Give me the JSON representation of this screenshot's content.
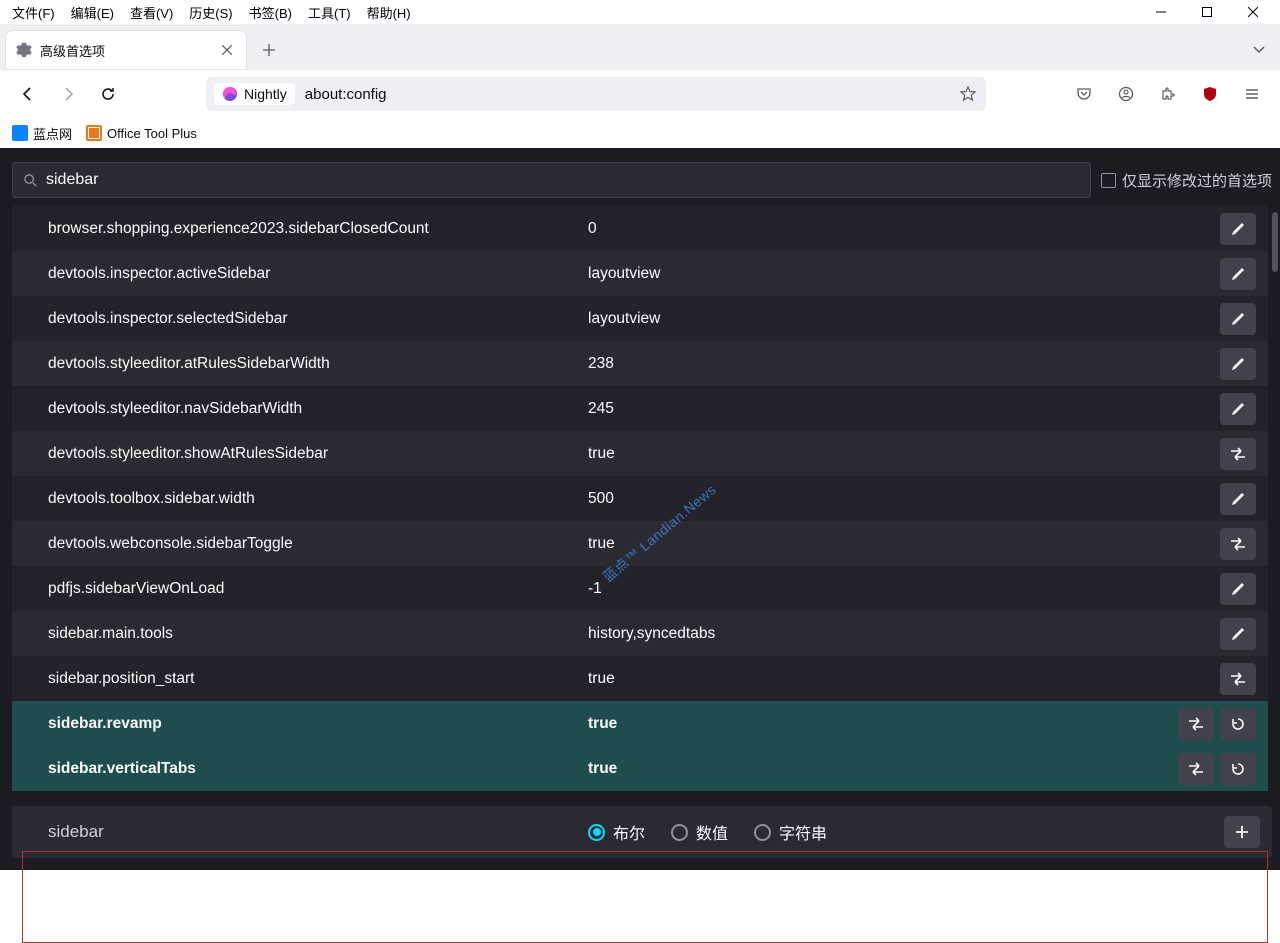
{
  "menubar": [
    "文件(F)",
    "编辑(E)",
    "查看(V)",
    "历史(S)",
    "书签(B)",
    "工具(T)",
    "帮助(H)"
  ],
  "tab": {
    "title": "高级首选项"
  },
  "urlbar": {
    "identity": "Nightly",
    "url": "about:config"
  },
  "bookmarks": [
    {
      "label": "蓝点网"
    },
    {
      "label": "Office Tool Plus"
    }
  ],
  "config": {
    "search_value": "sidebar",
    "modified_only_label": "仅显示修改过的首选项",
    "watermark": "蓝点™ Landian.News",
    "prefs": [
      {
        "name": "browser.shopping.experience2023.sidebarClosedCount",
        "value": "0",
        "action": "edit"
      },
      {
        "name": "devtools.inspector.activeSidebar",
        "value": "layoutview",
        "action": "edit"
      },
      {
        "name": "devtools.inspector.selectedSidebar",
        "value": "layoutview",
        "action": "edit"
      },
      {
        "name": "devtools.styleeditor.atRulesSidebarWidth",
        "value": "238",
        "action": "edit"
      },
      {
        "name": "devtools.styleeditor.navSidebarWidth",
        "value": "245",
        "action": "edit"
      },
      {
        "name": "devtools.styleeditor.showAtRulesSidebar",
        "value": "true",
        "action": "toggle"
      },
      {
        "name": "devtools.toolbox.sidebar.width",
        "value": "500",
        "action": "edit"
      },
      {
        "name": "devtools.webconsole.sidebarToggle",
        "value": "true",
        "action": "toggle"
      },
      {
        "name": "pdfjs.sidebarViewOnLoad",
        "value": "-1",
        "action": "edit"
      },
      {
        "name": "sidebar.main.tools",
        "value": "history,syncedtabs",
        "action": "edit"
      },
      {
        "name": "sidebar.position_start",
        "value": "true",
        "action": "toggle"
      },
      {
        "name": "sidebar.revamp",
        "value": "true",
        "action": "toggle",
        "reset": true,
        "highlighted": true
      },
      {
        "name": "sidebar.verticalTabs",
        "value": "true",
        "action": "toggle",
        "reset": true,
        "highlighted": true
      }
    ],
    "add": {
      "name": "sidebar",
      "types": [
        "布尔",
        "数值",
        "字符串"
      ],
      "selected": 0
    }
  }
}
